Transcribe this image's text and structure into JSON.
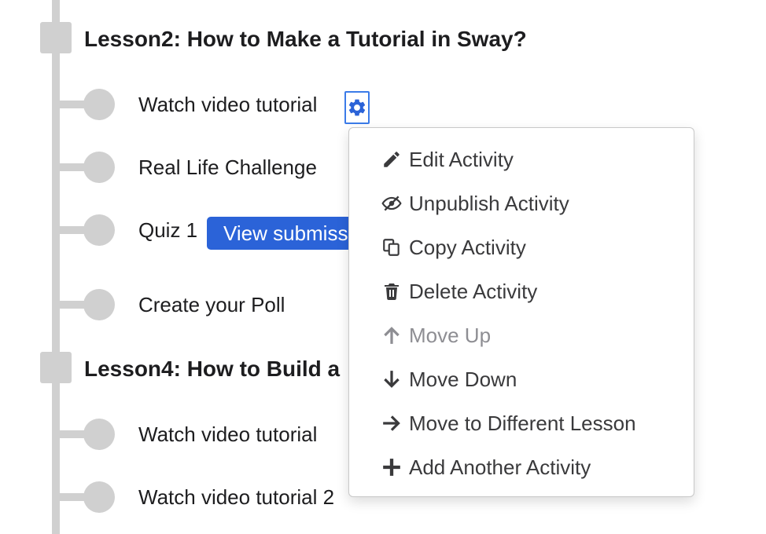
{
  "lessons": [
    {
      "title": "Lesson2: How to Make a Tutorial in Sway?",
      "activities": [
        {
          "label": "Watch video tutorial"
        },
        {
          "label": "Real Life Challenge"
        },
        {
          "label": "Quiz 1",
          "button": "View submissions"
        },
        {
          "label": "Create your Poll"
        }
      ]
    },
    {
      "title": "Lesson4: How to Build a",
      "activities": [
        {
          "label": "Watch video tutorial"
        },
        {
          "label": "Watch video tutorial 2"
        }
      ]
    }
  ],
  "context_menu": {
    "items": [
      {
        "label": "Edit Activity",
        "icon": "pencil-icon",
        "enabled": true
      },
      {
        "label": "Unpublish Activity",
        "icon": "eye-slash-icon",
        "enabled": true
      },
      {
        "label": "Copy Activity",
        "icon": "copy-icon",
        "enabled": true
      },
      {
        "label": "Delete Activity",
        "icon": "trash-icon",
        "enabled": true
      },
      {
        "label": "Move Up",
        "icon": "arrow-up-icon",
        "enabled": false
      },
      {
        "label": "Move Down",
        "icon": "arrow-down-icon",
        "enabled": true
      },
      {
        "label": "Move to Different Lesson",
        "icon": "arrow-right-icon",
        "enabled": true
      },
      {
        "label": "Add Another Activity",
        "icon": "plus-icon",
        "enabled": true
      }
    ]
  },
  "colors": {
    "accent": "#2b63d8",
    "focus_outline": "#3b7be8",
    "timeline": "#d0d0d0",
    "disabled_text": "#8e8e93"
  }
}
